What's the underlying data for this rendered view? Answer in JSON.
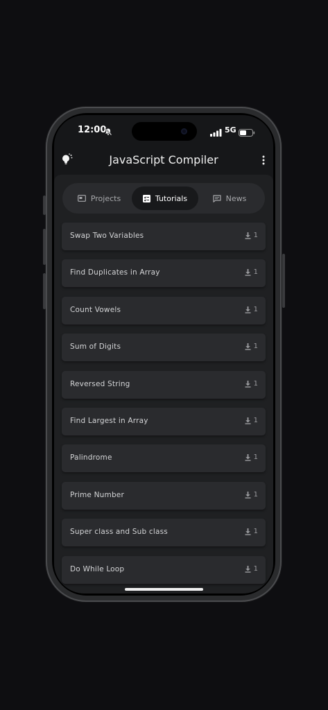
{
  "status_bar": {
    "time": "12:00",
    "network": "5G"
  },
  "header": {
    "title": "JavaScript Compiler"
  },
  "tabs": [
    {
      "label": "Projects",
      "icon": "window-icon",
      "active": false
    },
    {
      "label": "Tutorials",
      "icon": "checklist-icon",
      "active": true
    },
    {
      "label": "News",
      "icon": "chat-icon",
      "active": false
    }
  ],
  "tutorials": [
    {
      "title": "Swap Two Variables",
      "downloads": "1"
    },
    {
      "title": "Find Duplicates in Array",
      "downloads": "1"
    },
    {
      "title": "Count Vowels",
      "downloads": "1"
    },
    {
      "title": "Sum of Digits",
      "downloads": "1"
    },
    {
      "title": "Reversed String",
      "downloads": "1"
    },
    {
      "title": "Find Largest in Array",
      "downloads": "1"
    },
    {
      "title": "Palindrome",
      "downloads": "1"
    },
    {
      "title": "Prime Number",
      "downloads": "1"
    },
    {
      "title": "Super class and Sub class",
      "downloads": "1"
    },
    {
      "title": "Do While Loop",
      "downloads": "1"
    }
  ],
  "colors": {
    "background": "#0e0e11",
    "screen": "#161719",
    "panel": "#1f2022",
    "card": "#2a2b2e",
    "active_tab": "#18191b"
  }
}
